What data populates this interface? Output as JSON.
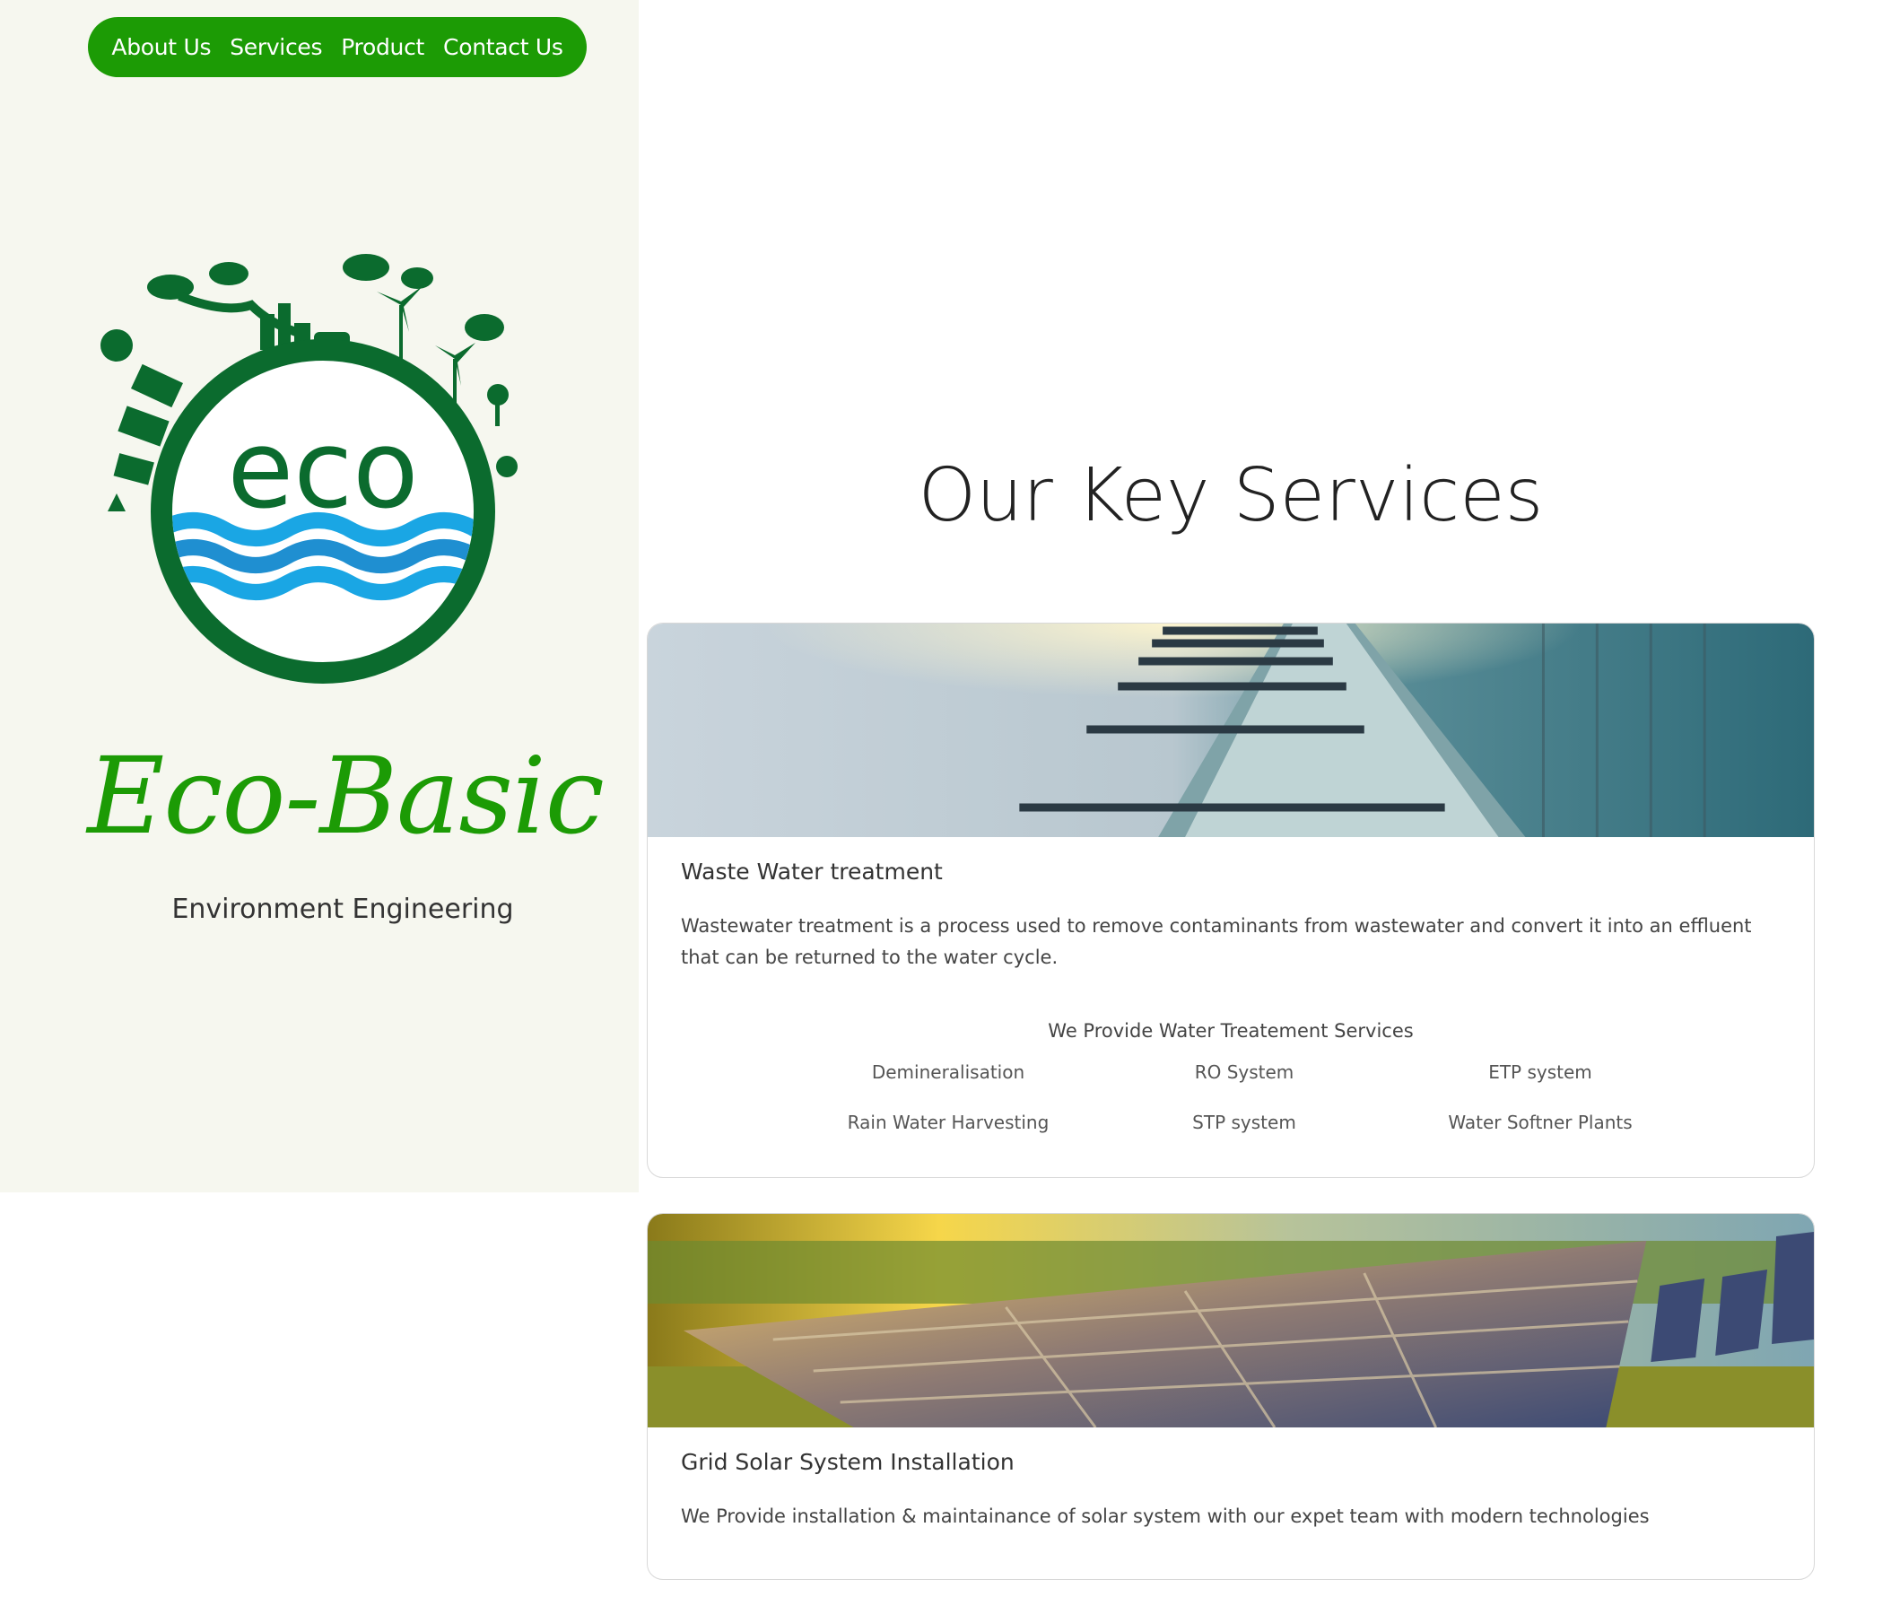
{
  "nav": {
    "items": [
      "About Us",
      "Services",
      "Product",
      "Contact Us"
    ]
  },
  "brand": {
    "logo_text": "eco",
    "name": "Eco-Basic",
    "subtitle": "Environment Engineering"
  },
  "section": {
    "title": "Our Key Services"
  },
  "cards": [
    {
      "title": "Waste Water treatment",
      "text": "Wastewater treatment is a process used to remove contaminants from wastewater and convert it into an effluent that can be returned to the water cycle.",
      "list_heading": "We Provide Water Treatement Services",
      "list": [
        "Demineralisation",
        "RO System",
        "ETP system",
        "Rain Water Harvesting",
        "STP system",
        "Water Softner Plants"
      ]
    },
    {
      "title": "Grid Solar System Installation",
      "text": "We Provide installation & maintainance of solar system with our expet team with modern technologies"
    }
  ],
  "colors": {
    "brand_green": "#1c9b05",
    "logo_dark_green": "#0b6b2e",
    "water_blue": "#1aa6e4",
    "sidebar_bg": "#f6f7ef"
  }
}
